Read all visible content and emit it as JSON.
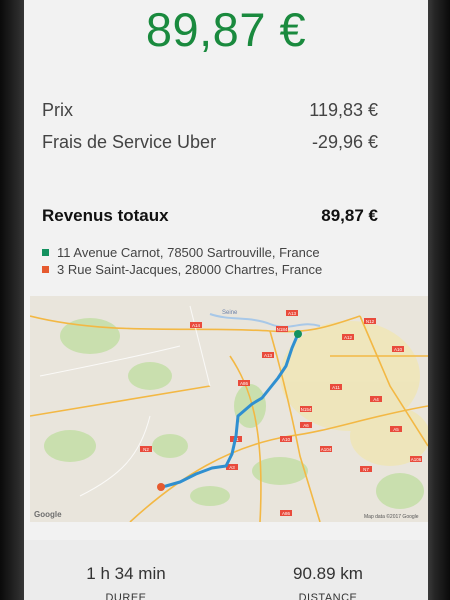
{
  "total_amount": "89,87 €",
  "breakdown": {
    "price_label": "Prix",
    "price_value": "119,83 €",
    "fee_label": "Frais de Service Uber",
    "fee_value": "-29,96 €",
    "total_label": "Revenus totaux",
    "total_value": "89,87 €"
  },
  "route": {
    "pickup": "11 Avenue Carnot, 78500 Sartrouville, France",
    "dropoff": "3 Rue Saint-Jacques, 28000 Chartres, France",
    "pickup_color": "#13915f",
    "dropoff_color": "#e65a2f",
    "route_color": "#2f8fd0"
  },
  "map": {
    "river_label": "Seine",
    "attribution": "Map data ©2017 Google",
    "logo": "Google",
    "road_labels": [
      "A13",
      "A14",
      "N184",
      "A13",
      "A86",
      "N12",
      "A12",
      "A10",
      "A11",
      "N154",
      "A10",
      "A6",
      "A4",
      "A5",
      "A106",
      "N7",
      "A104",
      "A1",
      "N2",
      "A3",
      "A86"
    ]
  },
  "trip": {
    "duration_value": "1 h 34 min",
    "duration_label": "DUREE",
    "distance_value": "90.89 km",
    "distance_label": "DISTANCE"
  }
}
